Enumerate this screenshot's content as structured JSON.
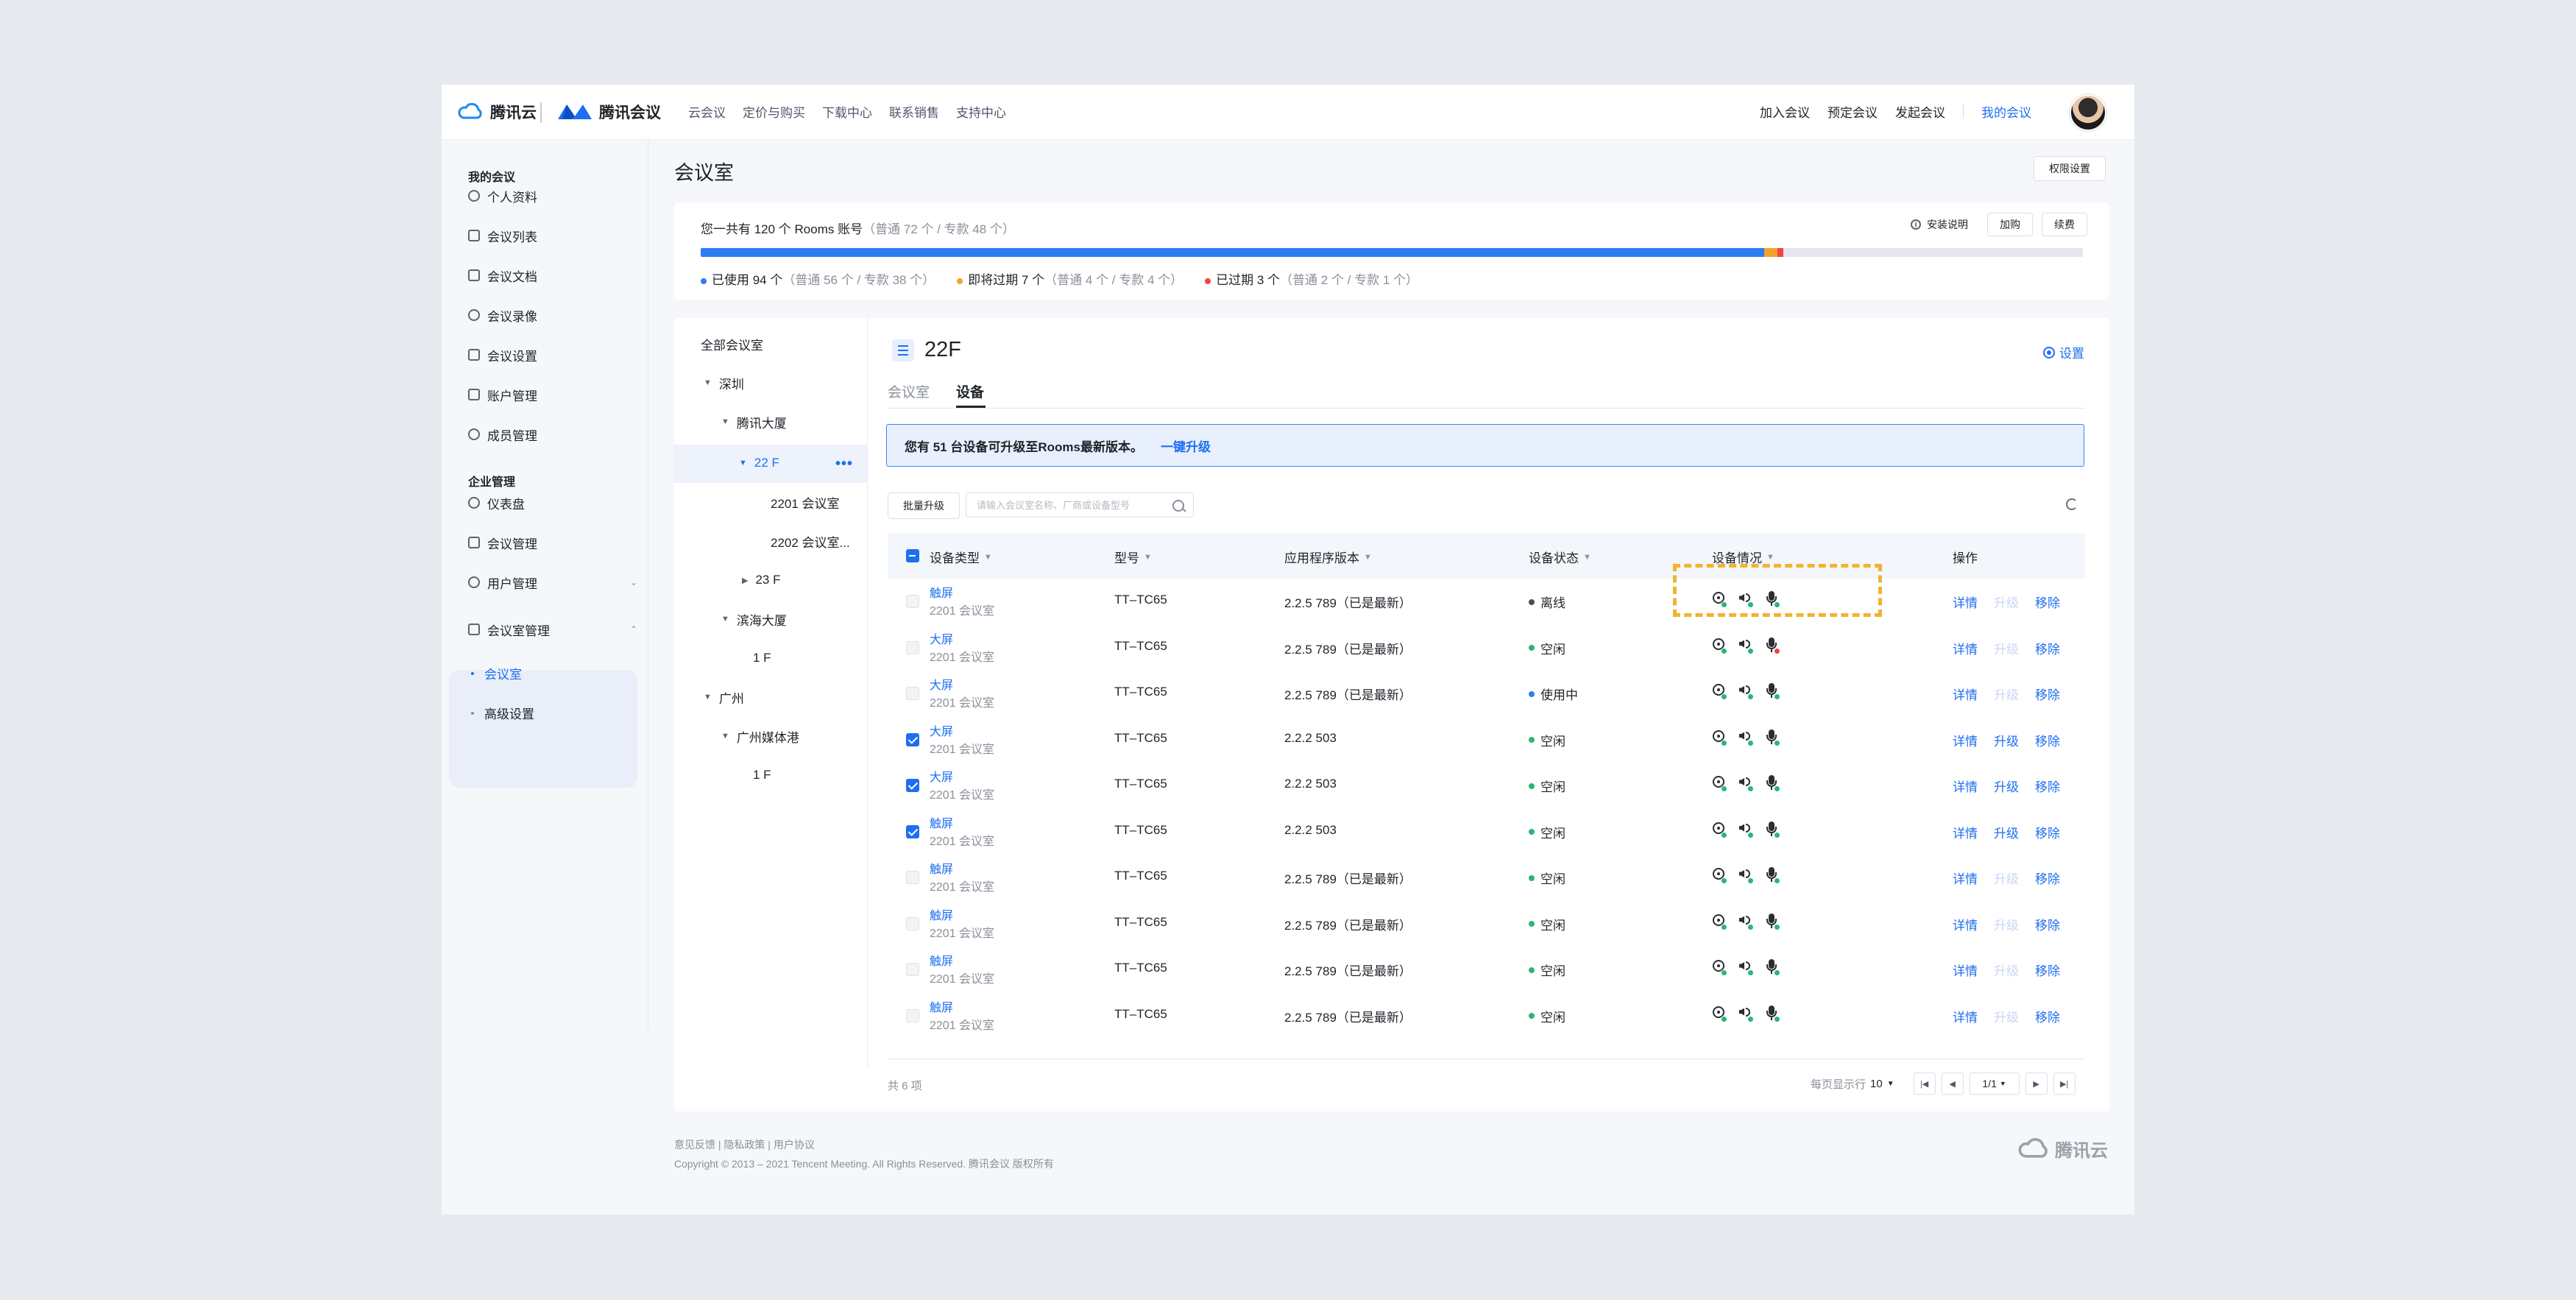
{
  "topbar": {
    "brand_tencent_cloud": "腾讯云",
    "brand_meeting": "腾讯会议",
    "nav_left": [
      "云会议",
      "定价与购买",
      "下载中心",
      "联系销售",
      "支持中心"
    ],
    "nav_right": [
      "加入会议",
      "预定会议",
      "发起会议",
      "我的会议"
    ],
    "nav_active": "我的会议"
  },
  "sidebar": {
    "group_my": "我的会议",
    "items_my": [
      "个人资料",
      "会议列表",
      "会议文档",
      "会议录像",
      "会议设置",
      "账户管理",
      "成员管理"
    ],
    "group_enterprise": "企业管理",
    "items_enterprise": [
      "仪表盘",
      "会议管理",
      "用户管理"
    ],
    "room_mgmt": "会议室管理",
    "room_sub": [
      "会议室",
      "高级设置"
    ],
    "active_sub": "会议室"
  },
  "page": {
    "title": "会议室",
    "perm_btn": "权限设置"
  },
  "summary": {
    "title_main": "您一共有 120 个 Rooms 账号",
    "title_detail": "（普通 72 个 / 专款 48 个）",
    "install": "安装说明",
    "buy": "加购",
    "renew": "续费",
    "used_label": "已使用 94 个",
    "used_detail": "（普通 56 个 / 专款 38 个）",
    "expiring_label": "即将过期 7 个",
    "expiring_detail": "（普通 4 个 / 专款 4 个）",
    "expired_label": "已过期 3 个",
    "expired_detail": "（普通 2 个 / 专款 1 个）",
    "bar": {
      "total": 120,
      "used": 94,
      "expiring": 7,
      "expired": 3
    },
    "colors": {
      "used": "#2d7df2",
      "expiring": "#f4a12b",
      "expired": "#ef4444"
    }
  },
  "tree": {
    "all": "全部会议室",
    "shenzhen": "深圳",
    "tencent_building": "腾讯大厦",
    "floor_22": "22 F",
    "room_2201": "2201 会议室",
    "room_2202": "2202 会议室...",
    "floor_23": "23 F",
    "binhai": "滨海大厦",
    "binhai_1f": "1 F",
    "guangzhou": "广州",
    "gz_media": "广州媒体港",
    "gz_1f": "1 F"
  },
  "room": {
    "name": "22F",
    "settings": "设置",
    "tabs": [
      "会议室",
      "设备"
    ],
    "active_tab": "设备",
    "notice": "您有 51 台设备可升级至Rooms最新版本。",
    "notice_link": "一键升级",
    "batch_upgrade": "批量升级",
    "search_placeholder": "请输入会议室名称、厂商或设备型号"
  },
  "table": {
    "headers": [
      "设备类型",
      "型号",
      "应用程序版本",
      "设备状态",
      "设备情况",
      "操作"
    ],
    "ops": [
      "详情",
      "升级",
      "移除"
    ],
    "rows": [
      {
        "type": "触屏",
        "room": "2201 会议室",
        "model": "TT–TC65",
        "version": "2.2.5 789（已是最新）",
        "status": "离线",
        "status_color": "#4a4f57",
        "checked": false,
        "upgradable": false,
        "dev": [
          "#2bb673",
          "#2bb673",
          "#2bb673"
        ]
      },
      {
        "type": "大屏",
        "room": "2201 会议室",
        "model": "TT–TC65",
        "version": "2.2.5 789（已是最新）",
        "status": "空闲",
        "status_color": "#2bb673",
        "checked": false,
        "upgradable": false,
        "dev": [
          "#2bb673",
          "#2bb673",
          "#ef4444"
        ]
      },
      {
        "type": "大屏",
        "room": "2201 会议室",
        "model": "TT–TC65",
        "version": "2.2.5 789（已是最新）",
        "status": "使用中",
        "status_color": "#2d7df2",
        "checked": false,
        "upgradable": false,
        "dev": [
          "#2bb673",
          "#2bb673",
          "#2bb673"
        ]
      },
      {
        "type": "大屏",
        "room": "2201 会议室",
        "model": "TT–TC65",
        "version": "2.2.2 503",
        "status": "空闲",
        "status_color": "#2bb673",
        "checked": true,
        "upgradable": true,
        "dev": [
          "#2bb673",
          "#2bb673",
          "#2bb673"
        ]
      },
      {
        "type": "大屏",
        "room": "2201 会议室",
        "model": "TT–TC65",
        "version": "2.2.2 503",
        "status": "空闲",
        "status_color": "#2bb673",
        "checked": true,
        "upgradable": true,
        "dev": [
          "#2bb673",
          "#2bb673",
          "#2bb673"
        ]
      },
      {
        "type": "触屏",
        "room": "2201 会议室",
        "model": "TT–TC65",
        "version": "2.2.2 503",
        "status": "空闲",
        "status_color": "#2bb673",
        "checked": true,
        "upgradable": true,
        "dev": [
          "#2bb673",
          "#2bb673",
          "#2bb673"
        ]
      },
      {
        "type": "触屏",
        "room": "2201 会议室",
        "model": "TT–TC65",
        "version": "2.2.5 789（已是最新）",
        "status": "空闲",
        "status_color": "#2bb673",
        "checked": false,
        "upgradable": false,
        "dev": [
          "#2bb673",
          "#2bb673",
          "#2bb673"
        ]
      },
      {
        "type": "触屏",
        "room": "2201 会议室",
        "model": "TT–TC65",
        "version": "2.2.5 789（已是最新）",
        "status": "空闲",
        "status_color": "#2bb673",
        "checked": false,
        "upgradable": false,
        "dev": [
          "#2bb673",
          "#2bb673",
          "#2bb673"
        ]
      },
      {
        "type": "触屏",
        "room": "2201 会议室",
        "model": "TT–TC65",
        "version": "2.2.5 789（已是最新）",
        "status": "空闲",
        "status_color": "#2bb673",
        "checked": false,
        "upgradable": false,
        "dev": [
          "#2bb673",
          "#2bb673",
          "#2bb673"
        ]
      },
      {
        "type": "触屏",
        "room": "2201 会议室",
        "model": "TT–TC65",
        "version": "2.2.5 789（已是最新）",
        "status": "空闲",
        "status_color": "#2bb673",
        "checked": false,
        "upgradable": false,
        "dev": [
          "#2bb673",
          "#2bb673",
          "#2bb673"
        ]
      }
    ],
    "total": "共 6 项",
    "per_page_label": "每页显示行",
    "per_page": "10",
    "page": "1/1"
  },
  "footer": {
    "links": "意见反馈 | 隐私政策 | 用户协议",
    "copyright": "Copyright © 2013 – 2021 Tencent Meeting. All Rights Reserved.  腾讯会议 版权所有",
    "logo": "腾讯云"
  }
}
